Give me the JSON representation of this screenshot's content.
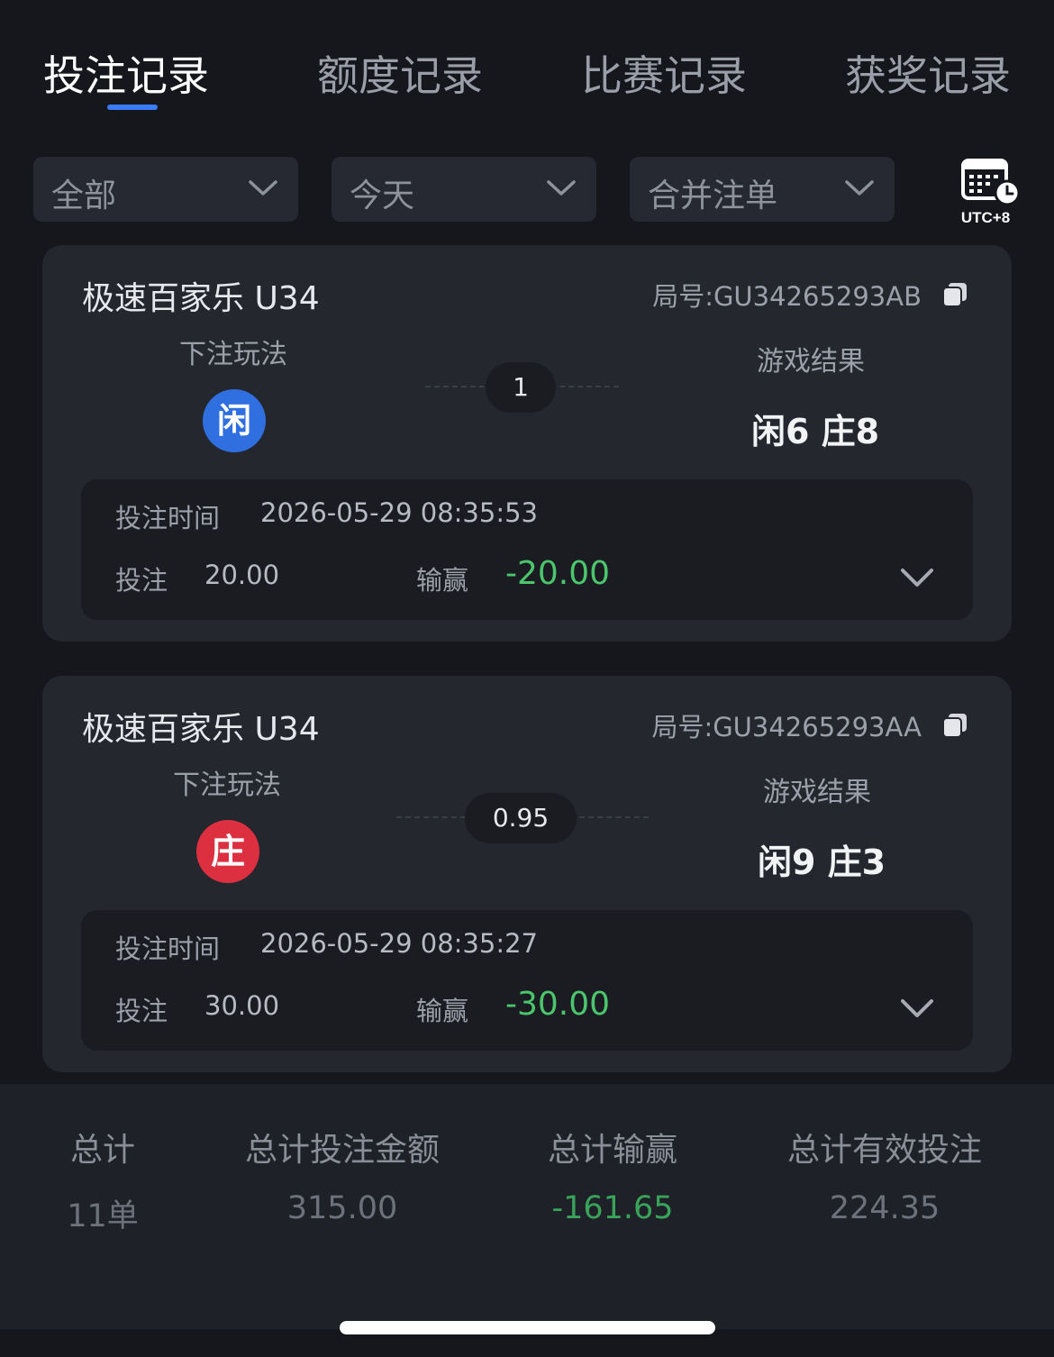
{
  "tabs": [
    {
      "label": "投注记录",
      "active": true
    },
    {
      "label": "额度记录",
      "active": false
    },
    {
      "label": "比赛记录",
      "active": false
    },
    {
      "label": "获奖记录",
      "active": false
    }
  ],
  "filters": {
    "category": "全部",
    "date": "今天",
    "mode": "合并注单",
    "timezone": "UTC+8"
  },
  "labels": {
    "bet_type": "下注玩法",
    "game_result": "游戏结果",
    "bet_time": "投注时间",
    "bet": "投注",
    "win_loss": "输赢"
  },
  "records": [
    {
      "game": "极速百家乐 U34",
      "round": "局号:GU34265293AB",
      "bet_side": "闲",
      "bet_side_color": "#2f6fe0",
      "odds": "1",
      "result": "闲6 庄8",
      "time": "2026-05-29 08:35:53",
      "amount": "20.00",
      "pnl": "-20.00"
    },
    {
      "game": "极速百家乐 U34",
      "round": "局号:GU34265293AA",
      "bet_side": "庄",
      "bet_side_color": "#dc2f3f",
      "odds": "0.95",
      "result": "闲9 庄3",
      "time": "2026-05-29 08:35:27",
      "amount": "30.00",
      "pnl": "-30.00"
    }
  ],
  "summary": {
    "total_label": "总计",
    "total_value": "11单",
    "bet_amount_label": "总计投注金额",
    "bet_amount_value": "315.00",
    "pnl_label": "总计输赢",
    "pnl_value": "-161.65",
    "valid_bet_label": "总计有效投注",
    "valid_bet_value": "224.35"
  },
  "colors": {
    "accent": "#3b7bf6",
    "loss_green": "#4cc66d"
  }
}
